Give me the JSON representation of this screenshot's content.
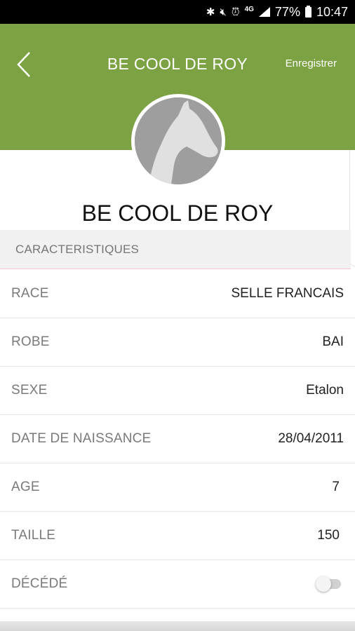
{
  "status_bar": {
    "network_label": "4G",
    "battery_percent": "77%",
    "time": "10:47"
  },
  "header": {
    "title": "BE COOL DE ROY",
    "save_label": "Enregistrer",
    "background_color": "#7ca244"
  },
  "profile": {
    "name": "BE COOL DE ROY"
  },
  "section": {
    "title": "CARACTERISTIQUES"
  },
  "fields": [
    {
      "label": "RACE",
      "value": "SELLE FRANCAIS"
    },
    {
      "label": "ROBE",
      "value": "BAI"
    },
    {
      "label": "SEXE",
      "value": "Etalon"
    },
    {
      "label": "DATE DE NAISSANCE",
      "value": "28/04/2011"
    },
    {
      "label": "AGE",
      "value": "7"
    },
    {
      "label": "TAILLE",
      "value": "150"
    },
    {
      "label": "DÉCÉDÉ",
      "toggle_on": false
    }
  ]
}
